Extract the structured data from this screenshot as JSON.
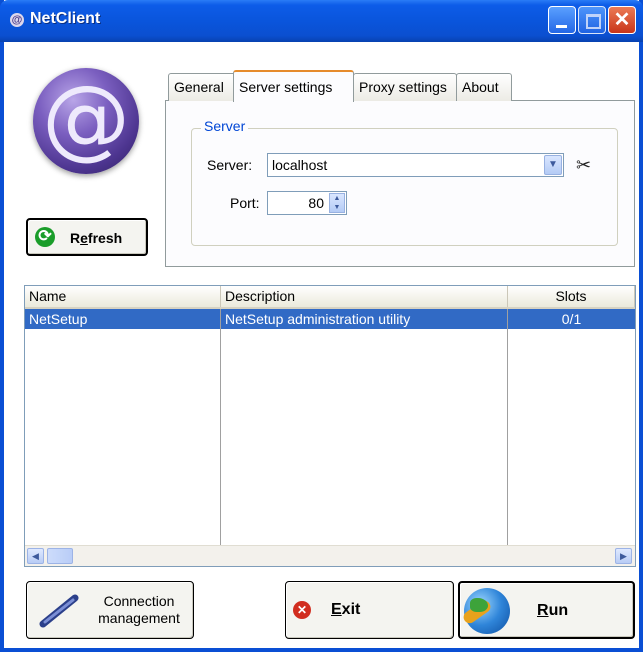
{
  "window": {
    "title": "NetClient",
    "icon": "at-sign-icon"
  },
  "colors": {
    "titlebar": "#0a55dc",
    "selection": "#316ac5",
    "tab_highlight": "#e68b2c",
    "group_label": "#0046d5"
  },
  "logo": {
    "glyph": "@"
  },
  "refresh_button": {
    "label_pre": "R",
    "label_mnemonic": "e",
    "label_post": "fresh",
    "icon": "refresh-arrows-icon"
  },
  "tabs": [
    {
      "label": "General",
      "active": false
    },
    {
      "label": "Server settings",
      "active": true
    },
    {
      "label": "Proxy settings",
      "active": false
    },
    {
      "label": "About",
      "active": false
    }
  ],
  "server_group": {
    "title": "Server",
    "server_label": "Server:",
    "server_value": "localhost",
    "port_label": "Port:",
    "port_value": "80"
  },
  "list": {
    "columns": [
      "Name",
      "Description",
      "Slots"
    ],
    "rows": [
      {
        "name": "NetSetup",
        "description": "NetSetup administration utility",
        "slots": "0/1",
        "selected": true
      }
    ]
  },
  "buttons": {
    "connection_line1": "Connection",
    "connection_line2": "management",
    "exit_mnemonic": "E",
    "exit_rest": "xit",
    "run_mnemonic": "R",
    "run_rest": "un"
  }
}
